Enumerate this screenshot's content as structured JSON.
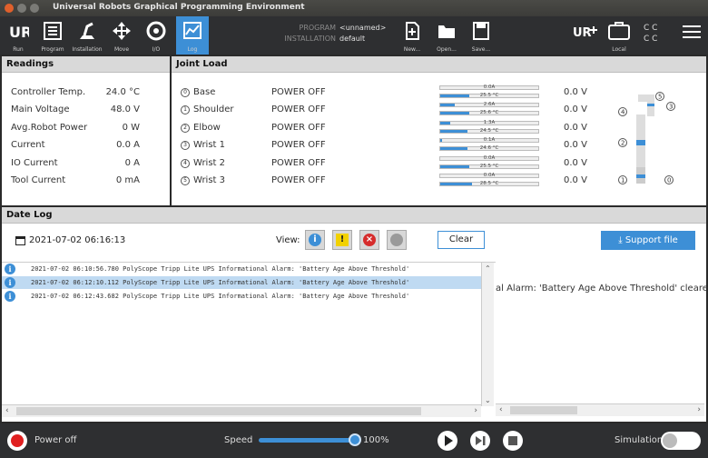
{
  "window": {
    "title": "Universal Robots Graphical Programming Environment"
  },
  "toolbar": {
    "buttons": [
      {
        "label": "Run",
        "icon": "ur-logo-icon"
      },
      {
        "label": "Program",
        "icon": "program-icon"
      },
      {
        "label": "Installation",
        "icon": "installation-icon"
      },
      {
        "label": "Move",
        "icon": "move-icon"
      },
      {
        "label": "I/O",
        "icon": "io-icon"
      },
      {
        "label": "Log",
        "icon": "log-icon"
      }
    ],
    "program_label": "PROGRAM",
    "program_value": "<unnamed>",
    "installation_label": "INSTALLATION",
    "installation_value": "default",
    "file_buttons": [
      "New...",
      "Open...",
      "Save..."
    ],
    "local_label": "Local",
    "cc_text": "C C"
  },
  "readings": {
    "title": "Readings",
    "rows": [
      {
        "label": "Controller Temp.",
        "value": "24.0 °C"
      },
      {
        "label": "Main Voltage",
        "value": "48.0 V"
      },
      {
        "label": "Avg.Robot Power",
        "value": "0 W"
      },
      {
        "label": "Current",
        "value": "0.0 A"
      },
      {
        "label": "IO Current",
        "value": "0 A"
      },
      {
        "label": "Tool Current",
        "value": "0 mA"
      }
    ]
  },
  "joint_load": {
    "title": "Joint Load",
    "joints": [
      {
        "num": "0",
        "name": "Base",
        "state": "POWER OFF",
        "current": "0.0A",
        "current_level": 0.0,
        "temp": "25.5 °C",
        "temp_level": 0.3,
        "voltage": "0.0 V"
      },
      {
        "num": "1",
        "name": "Shoulder",
        "state": "POWER OFF",
        "current": "2.6A",
        "current_level": 0.15,
        "temp": "25.6 °C",
        "temp_level": 0.3,
        "voltage": "0.0 V"
      },
      {
        "num": "2",
        "name": "Elbow",
        "state": "POWER OFF",
        "current": "1.3A",
        "current_level": 0.1,
        "temp": "24.5 °C",
        "temp_level": 0.28,
        "voltage": "0.0 V"
      },
      {
        "num": "3",
        "name": "Wrist 1",
        "state": "POWER OFF",
        "current": "0.1A",
        "current_level": 0.02,
        "temp": "24.6 °C",
        "temp_level": 0.28,
        "voltage": "0.0 V"
      },
      {
        "num": "4",
        "name": "Wrist 2",
        "state": "POWER OFF",
        "current": "0.0A",
        "current_level": 0.0,
        "temp": "25.5 °C",
        "temp_level": 0.3,
        "voltage": "0.0 V"
      },
      {
        "num": "5",
        "name": "Wrist 3",
        "state": "POWER OFF",
        "current": "0.0A",
        "current_level": 0.0,
        "temp": "28.5 °C",
        "temp_level": 0.32,
        "voltage": "0.0 V"
      }
    ],
    "diagram_labels": [
      "5",
      "3",
      "4",
      "2",
      "1",
      "0"
    ]
  },
  "date_log": {
    "title": "Date Log",
    "current_datetime": "2021-07-02 06:16:13",
    "view_label": "View:",
    "clear_label": "Clear",
    "support_label": "Support file",
    "entries": [
      {
        "text": "2021-07-02 06:10:56.780 PolyScope          Tripp Lite UPS Informational Alarm: 'Battery Age Above Threshold'",
        "selected": false
      },
      {
        "text": "2021-07-02 06:12:10.112 PolyScope          Tripp Lite UPS Informational Alarm: 'Battery Age Above Threshold'",
        "selected": true
      },
      {
        "text": "2021-07-02 06:12:43.682 PolyScope          Tripp Lite UPS Informational Alarm: 'Battery Age Above Threshold'",
        "selected": false
      }
    ],
    "detail_text": "al Alarm: 'Battery Age Above Threshold' cleared"
  },
  "bottombar": {
    "power_label": "Power off",
    "speed_label": "Speed",
    "speed_value": "100%",
    "speed_level": 1.0,
    "simulation_label": "Simulation"
  },
  "colors": {
    "accent": "#3d8fd6",
    "toolbar_bg": "#2e2f31",
    "power_red": "#e02020"
  }
}
